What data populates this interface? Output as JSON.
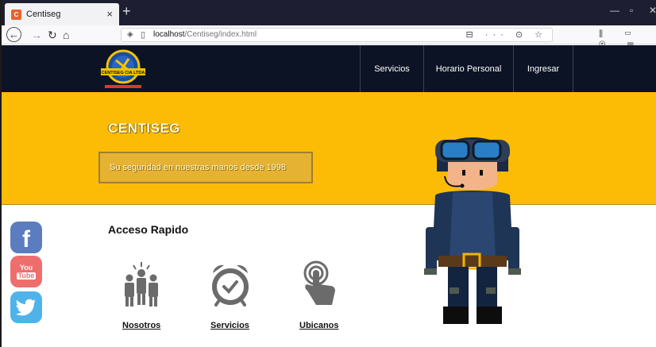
{
  "browser": {
    "tab_title": "Centiseg",
    "tab_close": "×",
    "new_tab": "+",
    "url_host": "localhost",
    "url_path": "/Centiseg/index.html",
    "url_actions": "⊟ ··· ⊙ ☆",
    "toolbar_icons": "⫼ ▭ ⊛ ☰"
  },
  "site": {
    "nav": [
      {
        "label": "Servicios"
      },
      {
        "label": "Horario Personal"
      },
      {
        "label": "Ingresar"
      }
    ],
    "logo_text": "CENTISEG CIA LTDA"
  },
  "hero": {
    "title": "CENTISEG",
    "slogan": "Su seguridad en nuestras manos desde 1998"
  },
  "quick_access": {
    "title": "Acceso Rapido",
    "items": [
      {
        "label": "Nosotros",
        "icon": "team-icon"
      },
      {
        "label": "Servicios",
        "icon": "alarm-clock-icon"
      },
      {
        "label": "Ubicanos",
        "icon": "touch-hand-icon"
      }
    ]
  },
  "social": {
    "facebook": "f",
    "youtube_top": "You",
    "youtube_bottom": "Tube"
  },
  "colors": {
    "header_bg": "#0c1324",
    "hero_bg": "#fcbc05",
    "icon_gray": "#6b6b6b"
  }
}
